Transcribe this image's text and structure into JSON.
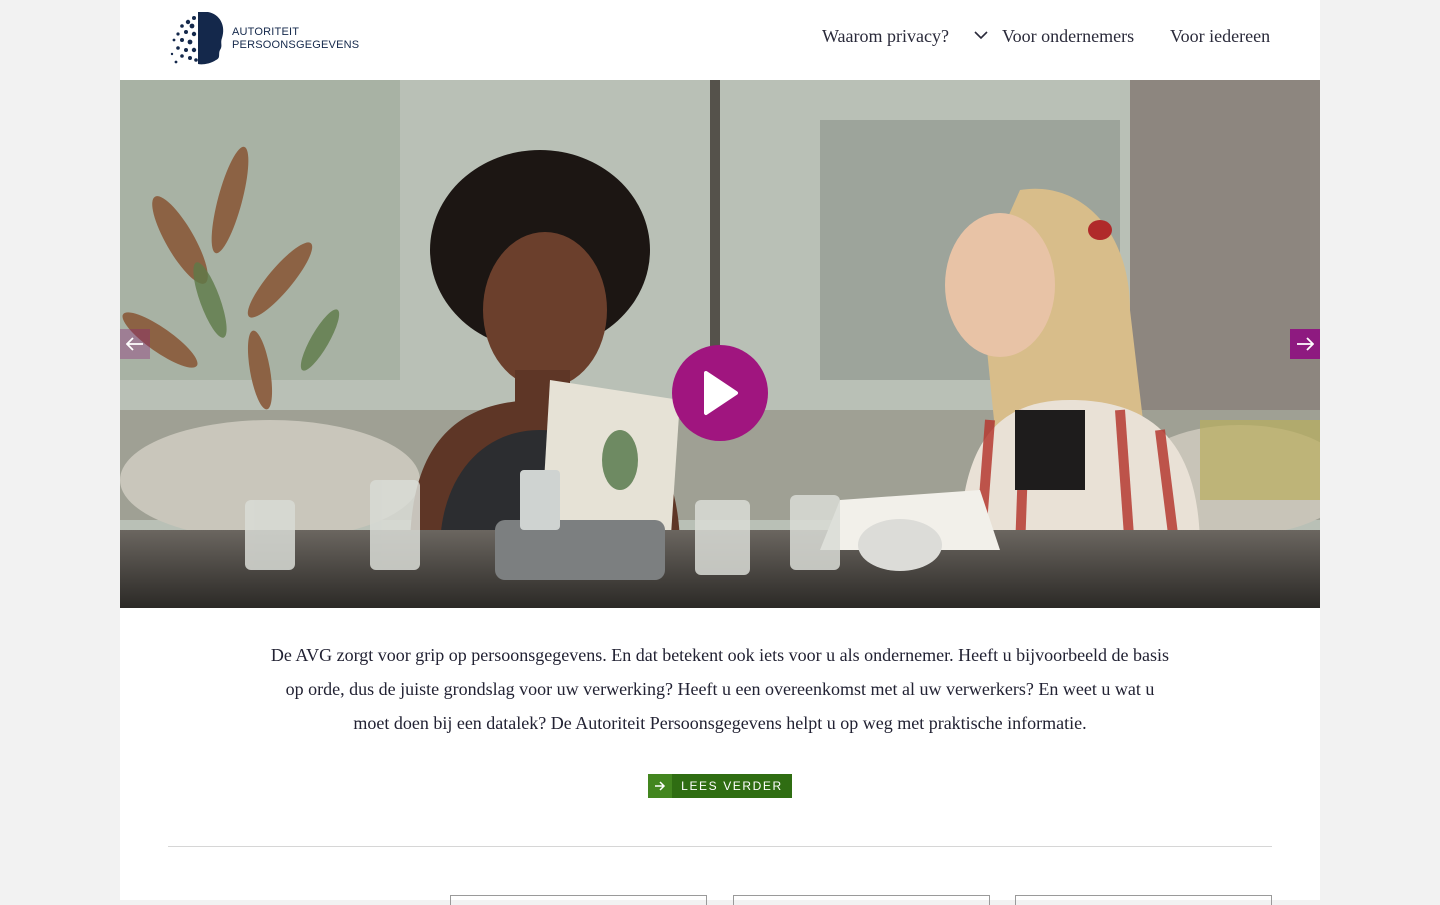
{
  "header": {
    "logo_line1": "AUTORITEIT",
    "logo_line2": "PERSOONSGEGEVENS",
    "nav": [
      {
        "label": "Waarom privacy?"
      },
      {
        "label": "Voor ondernemers"
      },
      {
        "label": "Voor iedereen"
      }
    ]
  },
  "hero": {
    "prev_icon": "arrow-left-icon",
    "next_icon": "arrow-right-icon",
    "play_icon": "play-icon"
  },
  "intro": {
    "text": "De AVG zorgt voor grip op persoonsgegevens. En dat betekent ook iets voor u als ondernemer. Heeft u bijvoorbeeld de basis op orde, dus de juiste grondslag voor uw verwerking? Heeft u een overeenkomst met al uw verwerkers? En weet u wat u moet doen bij een datalek? De Autoriteit Persoonsgegevens helpt u op weg met praktische informatie."
  },
  "cta": {
    "label": "LEES VERDER"
  },
  "colors": {
    "accent": "#a0157f",
    "cta": "#2f6d12",
    "brand": "#14284b"
  }
}
